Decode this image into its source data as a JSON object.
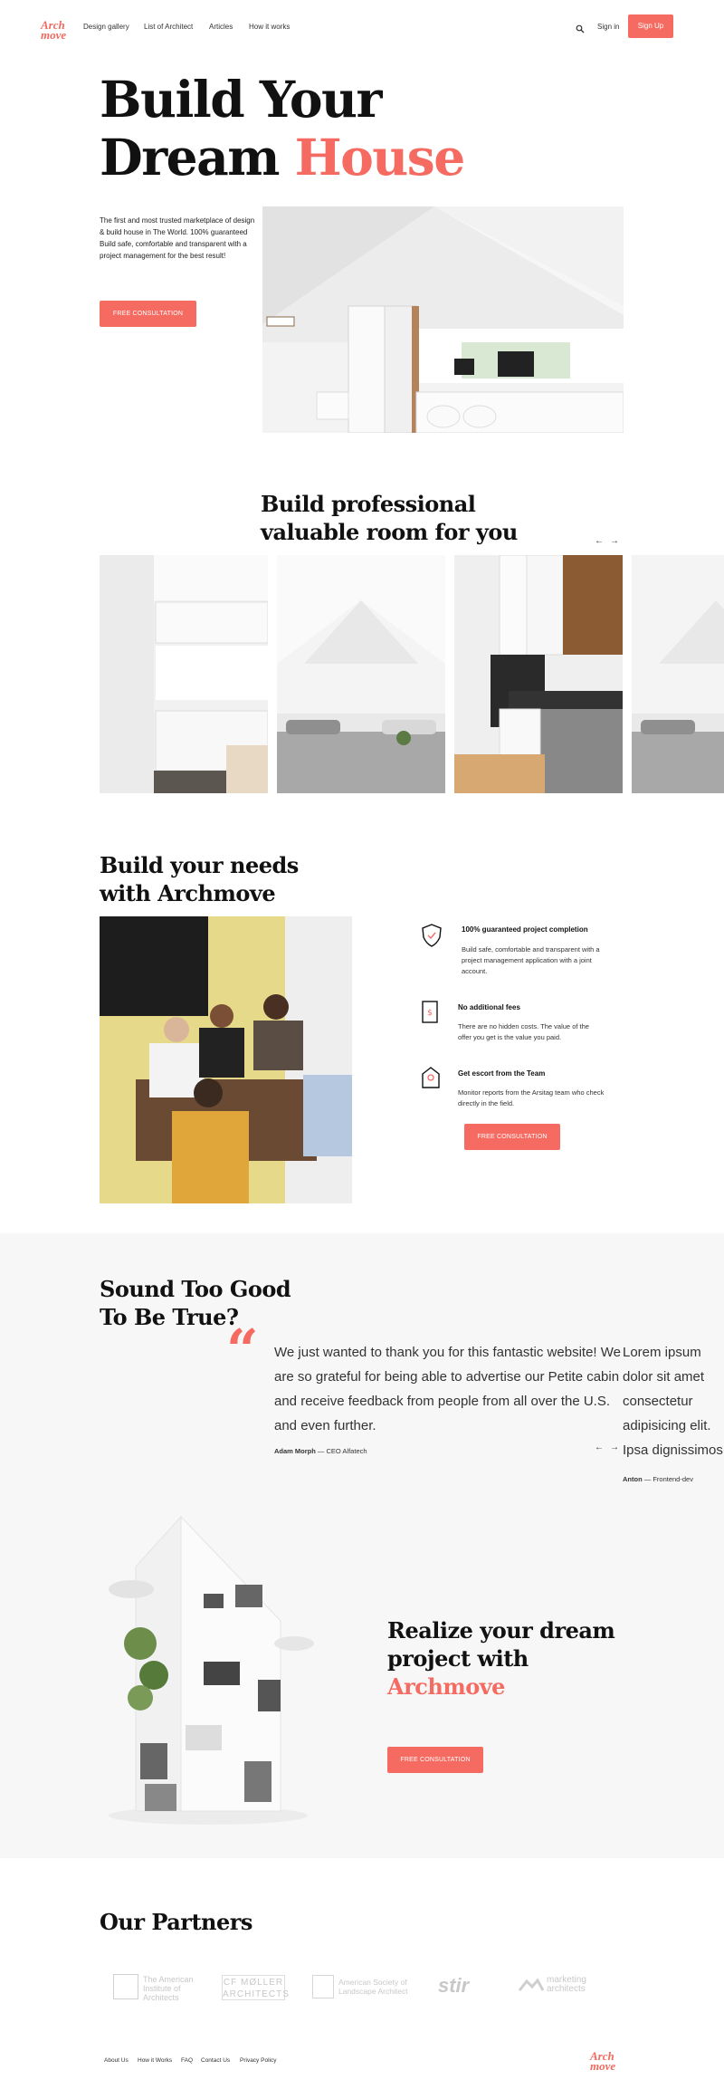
{
  "brand": {
    "logo_top": "Arch",
    "logo_bottom": "move"
  },
  "nav": {
    "links": [
      "Design gallery",
      "List of Architect",
      "Articles",
      "How it works"
    ],
    "sign_in": "Sign in",
    "sign_up": "Sign Up"
  },
  "hero": {
    "title_line1": "Build Your",
    "title_line2_plain": "Dream ",
    "title_line2_accent": "House",
    "description": "The first and most trusted marketplace of design & build house in The World. 100% guaranteed Build safe, comfortable and transparent with a project management for the best result!",
    "cta": "FREE CONSULTATION"
  },
  "rooms": {
    "title_line1": "Build professional",
    "title_line2": "valuable room for you",
    "prev": "←",
    "next": "→"
  },
  "needs": {
    "title_line1": "Build your needs",
    "title_line2": "with Archmove",
    "features": [
      {
        "title": "100% guaranteed project completion",
        "desc": "Build safe, comfortable and transparent with a project management application with a joint account."
      },
      {
        "title": "No additional fees",
        "desc": "There are no hidden costs. The value of the offer you get is the value you paid."
      },
      {
        "title": "Get escort from the Team",
        "desc": "Monitor reports from the Arsitag team who check directly in the field."
      }
    ],
    "cta": "FREE CONSULTATION"
  },
  "testimonials": {
    "title_line1": "Sound Too Good",
    "title_line2": "To Be True?",
    "quote_mark": "“",
    "items": [
      {
        "text": "We just wanted to thank you for this fantastic website! We are so grateful for being able to advertise our Petite cabin and receive feedback from people from all over the U.S. and even further.",
        "name": "Adam Morph",
        "role": " — CEO Alfatech"
      },
      {
        "text": "Lorem ipsum dolor sit amet consectetur adipisicing elit. Ipsa dignissimos similique laborum cumque, odit, beatae repudiandae dueis",
        "name": "Anton",
        "role": " — Frontend-dev"
      }
    ],
    "prev": "←",
    "next": "→"
  },
  "realize": {
    "title_line1": "Realize your dream",
    "title_line2": "project with",
    "title_accent": "Archmove",
    "cta": "FREE CONSULTATION"
  },
  "partners": {
    "title": "Our Partners",
    "items": [
      "The American Institute of Architects",
      "CF MØLLER ARCHITECTS",
      "American Society of Landscape Architect",
      "stir",
      "marketing architects"
    ]
  },
  "footer": {
    "links": [
      "About Us",
      "How it Works",
      "FAQ",
      "Contact Us",
      "Privacy Policy"
    ]
  },
  "colors": {
    "accent": "#f66b61",
    "section_bg": "#f7f7f7"
  }
}
